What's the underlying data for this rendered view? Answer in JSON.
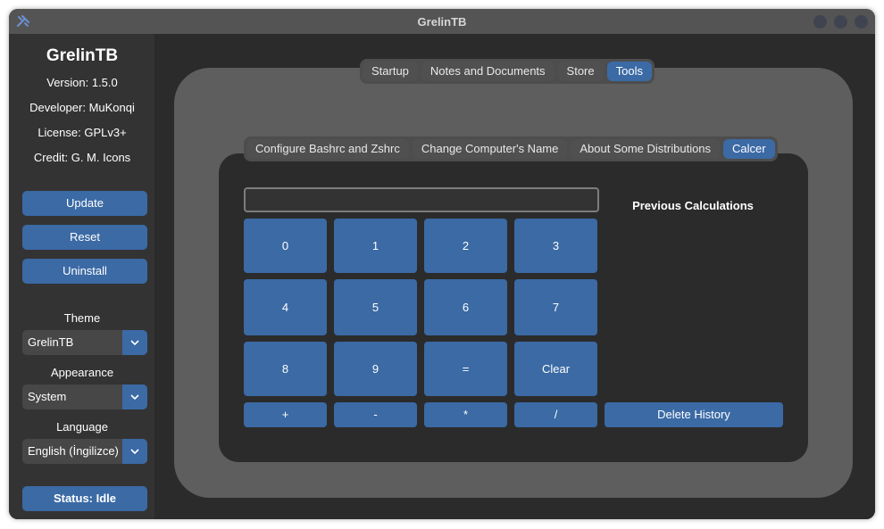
{
  "window": {
    "title": "GrelinTB",
    "app_icon": "tools-icon"
  },
  "sidebar": {
    "app_name": "GrelinTB",
    "version": "Version: 1.5.0",
    "developer": "Developer: MuKonqi",
    "license": "License: GPLv3+",
    "credit": "Credit: G. M. Icons",
    "buttons": {
      "update": "Update",
      "reset": "Reset",
      "uninstall": "Uninstall"
    },
    "theme": {
      "label": "Theme",
      "value": "GrelinTB"
    },
    "appearance": {
      "label": "Appearance",
      "value": "System"
    },
    "language": {
      "label": "Language",
      "value": "English (İngilizce)"
    },
    "status": "Status: Idle"
  },
  "main_tabs": [
    "Startup",
    "Notes and Documents",
    "Store",
    "Tools"
  ],
  "main_tabs_active": "Tools",
  "tool_tabs": [
    "Configure Bashrc and Zshrc",
    "Change Computer's Name",
    "About Some Distributions",
    "Calcer"
  ],
  "tool_tabs_active": "Calcer",
  "calcer": {
    "input_value": "",
    "keys_row1": [
      "0",
      "1",
      "2",
      "3"
    ],
    "keys_row2": [
      "4",
      "5",
      "6",
      "7"
    ],
    "keys_row3": [
      "8",
      "9",
      "=",
      "Clear"
    ],
    "keys_row4": [
      "+",
      "-",
      "*",
      "/"
    ],
    "previous_title": "Previous Calculations",
    "delete_history": "Delete History"
  },
  "colors": {
    "accent": "#3b6aa5",
    "window_bg": "#2b2b2b",
    "sidebar_bg": "#333333",
    "panel_bg": "#5e5e5e",
    "titlebar_bg": "#545454"
  }
}
